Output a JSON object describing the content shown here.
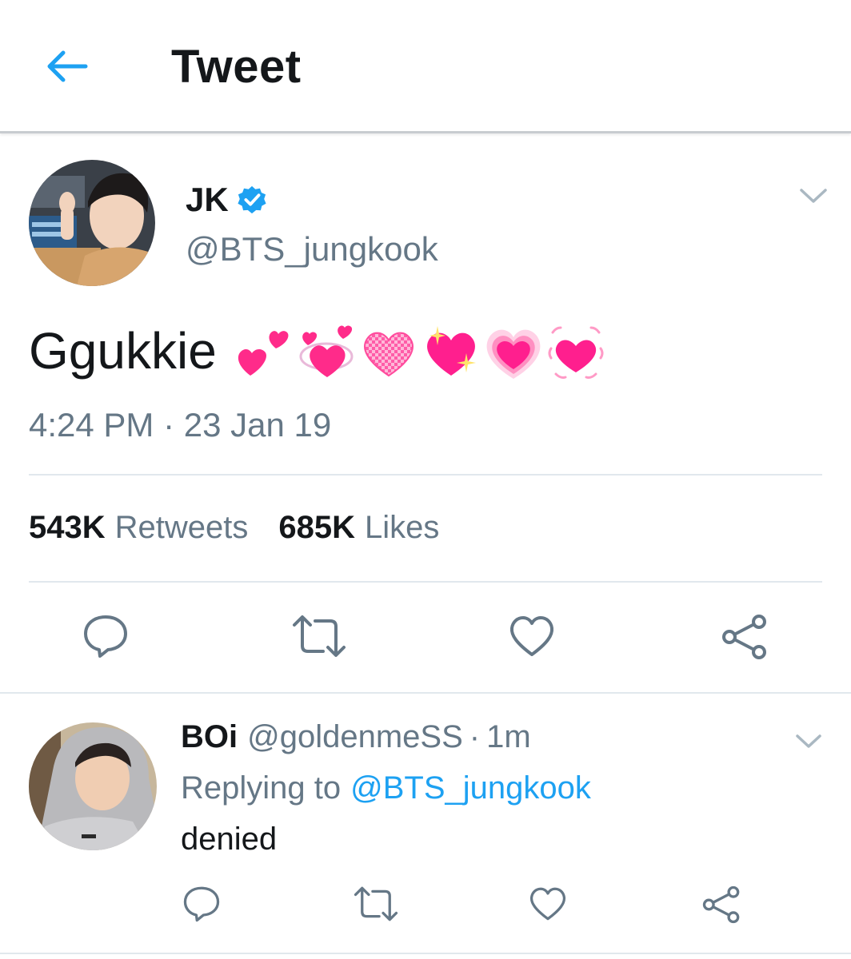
{
  "header": {
    "title": "Tweet",
    "back_icon": "arrow-left-icon",
    "accent_color": "#1da1f2"
  },
  "tweet": {
    "display_name": "JK",
    "verified": true,
    "handle": "@BTS_jungkook",
    "text": "Ggukkie",
    "emojis": [
      "two-hearts",
      "revolving-hearts",
      "checkered-heart",
      "sparkling-heart",
      "growing-heart",
      "beating-heart"
    ],
    "timestamp": "4:24 PM · 23 Jan 19",
    "stats": {
      "retweets_count": "543K",
      "retweets_label": "Retweets",
      "likes_count": "685K",
      "likes_label": "Likes"
    },
    "actions": [
      "reply-icon",
      "retweet-icon",
      "like-icon",
      "share-icon"
    ]
  },
  "reply": {
    "display_name": "BOi",
    "handle": "@goldenmeSS",
    "separator": "·",
    "time": "1m",
    "replying_prefix": "Replying to",
    "replying_to": "@BTS_jungkook",
    "text": "denied",
    "actions": [
      "reply-icon",
      "retweet-icon",
      "like-icon",
      "share-icon"
    ]
  }
}
